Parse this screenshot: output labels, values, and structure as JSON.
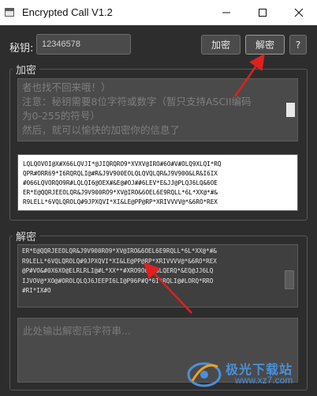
{
  "window": {
    "title": "Encrypted Call V1.2"
  },
  "key_row": {
    "label": "秘钥:",
    "value": "12346578",
    "encrypt_label": "加密",
    "decrypt_label": "解密",
    "help_label": "?"
  },
  "encrypt_group": {
    "title": "加密",
    "plain_lines": [
      "者也找不回来哦！）",
      "注意：秘钥需要8位字符或数字（暂只支持ASCII编码",
      "为0-255的符号）",
      "然后，就可以愉快的加密你的信息了"
    ],
    "cipher_lines": [
      "LQLQOVOI@X#X66LQVJI*@JIQRQRO9*XVXV@IRO#6O#V#OLQ9XLQI*RQ",
      "QPR#ORR69*I6RQRQLI@#R&J9V900EOLQLQVQLQR&J9V900&LR&I6IX",
      "#066LQVORQO9R#LQLQI6@OEX#&E@#OJ##6LEV*E&JJ@PLQJ6LQ&6OE",
      "ER*E@QQRJEEOLQR&J9V900RO9*XV@IRO&6OEL6E9RQLL*6L*XX@*#&",
      "R9LELL*6VQLQROLQ#9JPXQVI*XI&LE@PP@RP*XRIVVVV@*&6RO*REX"
    ]
  },
  "decrypt_group": {
    "title": "解密",
    "cipher_lines": [
      "ER*E@QQRJEEOLQR&J9V900RO9*XV@IRO&6OEL6E9RQLL*6L*XX@*#&",
      "R9LELL*6VQLQROLQ#9JPXQVI*XI&LE@PP@RP*XRIVVVV@*&6RO*REX",
      "@P#VO&#0X6XO@ELRLRLI@#L*XX**#XRO9O0EJ6LQERQ*&EQ@JJ6LQ",
      "IJVOV@*XO@#OROLQLQJ6JEEPI6LI@P96P#Q*6I*RQLI@#LORQ*RRO",
      "#RI*IX#O"
    ],
    "output_placeholder": "此处输出解密后字符串..."
  },
  "watermark": {
    "brand": "极光下载站",
    "url": "www.xz7.com",
    "icon": "aurora-logo-icon"
  },
  "colors": {
    "background": "#2d2d2d",
    "input": "#4a4a4a",
    "annotation_arrow": "#e02020",
    "watermark": "#4a90d9"
  }
}
